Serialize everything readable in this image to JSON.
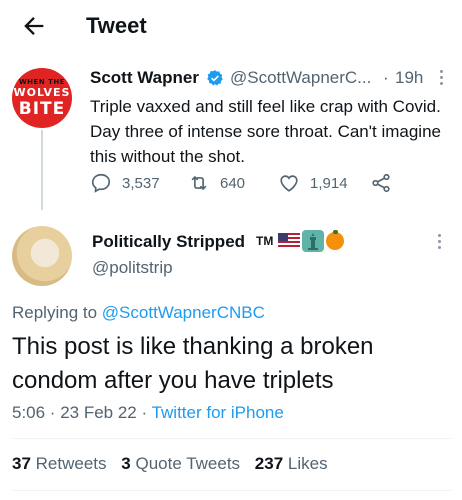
{
  "header": {
    "title": "Tweet"
  },
  "parent_tweet": {
    "avatar_text": {
      "top": "WHEN THE",
      "mid": "WOLVES",
      "bottom": "BITE"
    },
    "name": "Scott Wapner",
    "handle": "@ScottWapnerC...",
    "separator": "·",
    "time": "19h",
    "text": "Triple vaxxed and still feel like crap with Covid.  Day three of intense sore throat. Can't imagine this without the shot.",
    "replies": "3,537",
    "retweets": "640",
    "likes": "1,914",
    "icons": [
      "reply-icon",
      "retweet-icon",
      "like-icon",
      "share-icon",
      "verified-badge-icon",
      "more-icon"
    ]
  },
  "reply_tweet": {
    "name": "Politically Stripped",
    "tm": "TM",
    "handle": "@politstrip",
    "replying_prefix": "Replying to",
    "replying_to": "@ScottWapnerCNBC",
    "text": "This post is like thanking a broken condom after you have triplets",
    "time": "5:06 · 23 Feb 22 · ",
    "source": "Twitter for iPhone",
    "stats": {
      "retweets_count": "37",
      "retweets_label": "Retweets",
      "quotes_count": "3",
      "quotes_label": "Quote Tweets",
      "likes_count": "237",
      "likes_label": "Likes"
    },
    "emoji": [
      "us-flag-icon",
      "statue-of-liberty-icon",
      "orange-icon"
    ]
  },
  "colors": {
    "accent": "#1d9bf0",
    "text": "#0f1419",
    "muted": "#536471",
    "avatar_red": "#e02424"
  }
}
